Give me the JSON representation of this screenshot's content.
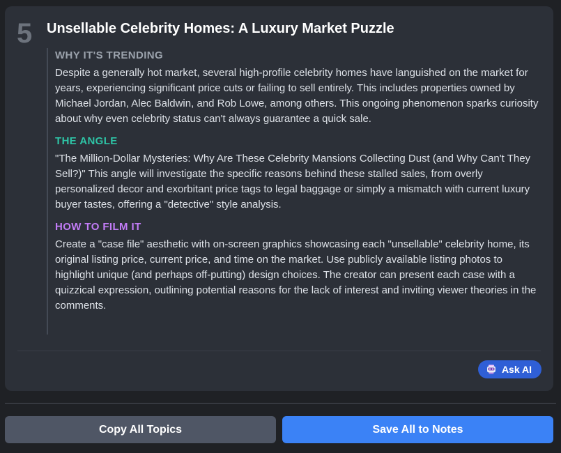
{
  "topic": {
    "number": "5",
    "title": "Unsellable Celebrity Homes: A Luxury Market Puzzle",
    "sections": [
      {
        "heading": "WHY IT'S TRENDING",
        "body": "Despite a generally hot market, several high-profile celebrity homes have languished on the market for years, experiencing significant price cuts or failing to sell entirely. This includes properties owned by Michael Jordan, Alec Baldwin, and Rob Lowe, among others. This ongoing phenomenon sparks curiosity about why even celebrity status can't always guarantee a quick sale."
      },
      {
        "heading": "THE ANGLE",
        "body": "\"The Million-Dollar Mysteries: Why Are These Celebrity Mansions Collecting Dust (and Why Can't They Sell?)\" This angle will investigate the specific reasons behind these stalled sales, from overly personalized decor and exorbitant price tags to legal baggage or simply a mismatch with current luxury buyer tastes, offering a \"detective\" style analysis."
      },
      {
        "heading": "HOW TO FILM IT",
        "body": "Create a \"case file\" aesthetic with on-screen graphics showcasing each \"unsellable\" celebrity home, its original listing price, current price, and time on the market. Use publicly available listing photos to highlight unique (and perhaps off-putting) design choices. The creator can present each case with a quizzical expression, outlining potential reasons for the lack of interest and inviting viewer theories in the comments."
      }
    ],
    "ask_ai_label": "Ask AI",
    "ask_ai_icon": "robot-icon"
  },
  "actions": {
    "copy_all_label": "Copy All Topics",
    "save_all_label": "Save All to Notes"
  },
  "colors": {
    "background": "#1f2125",
    "card": "#2c3038",
    "trending_heading": "#9ca3ad",
    "angle_heading": "#2ec4a6",
    "film_heading": "#c27cf7",
    "ask_ai_button": "#2f5fd6",
    "copy_button": "#4f5665",
    "save_button": "#3b82f6"
  }
}
